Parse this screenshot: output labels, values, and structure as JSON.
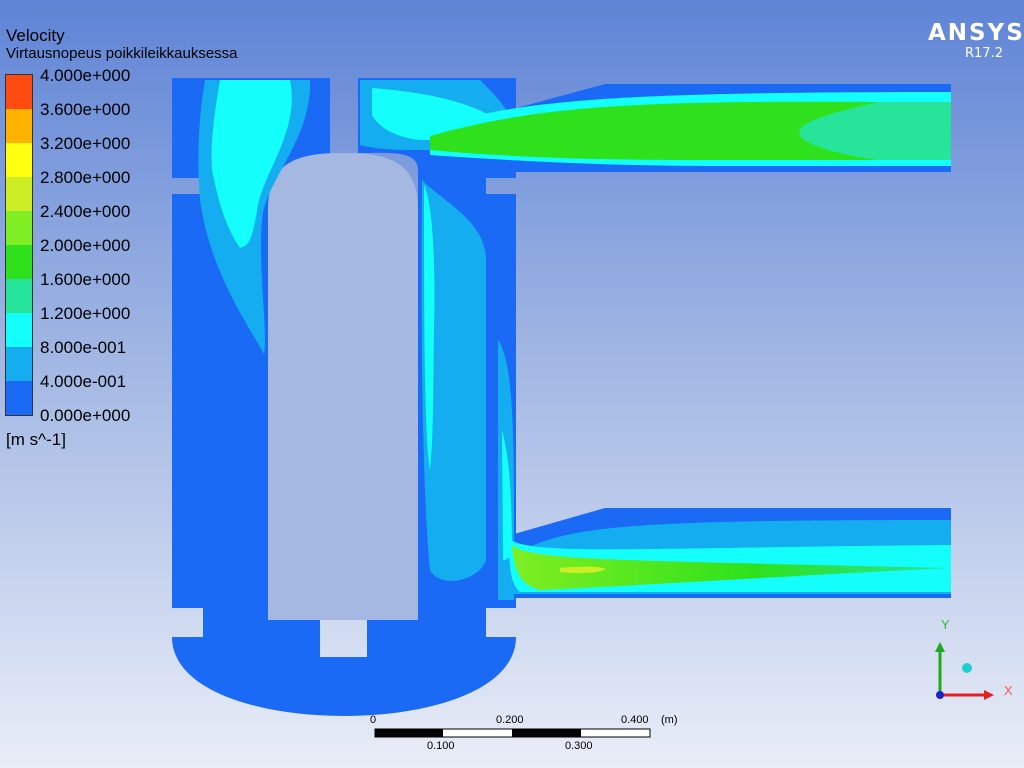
{
  "legend": {
    "title": "Velocity",
    "subtitle": "Virtausnopeus poikkileikkauksessa",
    "ticks": [
      "4.000e+000",
      "3.600e+000",
      "3.200e+000",
      "2.800e+000",
      "2.400e+000",
      "2.000e+000",
      "1.600e+000",
      "1.200e+000",
      "8.000e-001",
      "4.000e-001",
      "0.000e+000"
    ],
    "units": "[m s^-1]",
    "colors": [
      "#ff4a12",
      "#ffb300",
      "#ffff10",
      "#cdee25",
      "#7fee22",
      "#2ee11c",
      "#26e59b",
      "#14fffc",
      "#14aef0",
      "#1a6af5"
    ]
  },
  "branding": {
    "logo": "ANSYS",
    "version": "R17.2"
  },
  "scale": {
    "top_labels": [
      "0",
      "0.200",
      "0.400"
    ],
    "bottom_labels": [
      "0.100",
      "0.300"
    ],
    "unit": "(m)"
  },
  "axes": {
    "x": "X",
    "y": "Y"
  }
}
